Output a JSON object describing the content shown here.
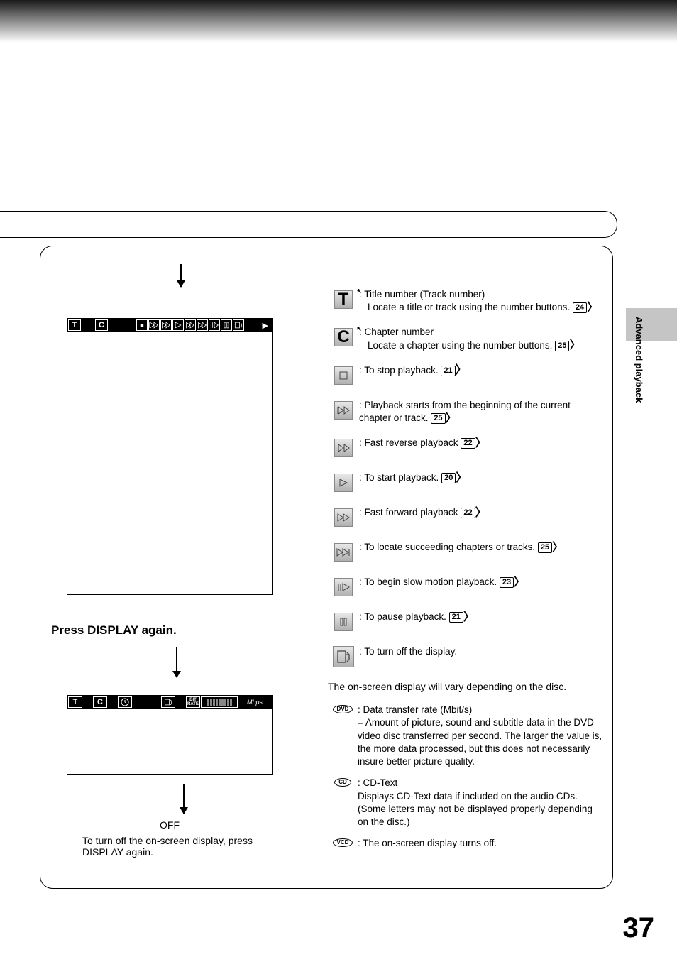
{
  "side_label": "Advanced playback",
  "page_number": "37",
  "press_heading": "Press DISPLAY again.",
  "off_label": "OFF",
  "off_note": "To turn off the on-screen display, press DISPLAY again.",
  "osd1": {
    "t": "T",
    "c": "C"
  },
  "osd2": {
    "t": "T",
    "c": "C",
    "bitrate_label": "BIT RATE",
    "mbps": "Mbps"
  },
  "legend": {
    "title": {
      "letter": "T",
      "star": "*",
      "main": ": Title number (Track number)",
      "desc": "Locate a title or track using the number buttons.",
      "ref": "24"
    },
    "chapter": {
      "letter": "C",
      "star": "*",
      "main": ": Chapter number",
      "desc": "Locate a chapter using the number buttons.",
      "ref": "25"
    },
    "stop": {
      "main": ": To stop playback.",
      "ref": "21"
    },
    "prev": {
      "main": ": Playback starts from the beginning of the current chapter or track.",
      "ref": "25"
    },
    "rev": {
      "main": ": Fast reverse playback",
      "ref": "22"
    },
    "play": {
      "main": ": To start playback.",
      "ref": "20"
    },
    "ff": {
      "main": ": Fast forward playback",
      "ref": "22"
    },
    "next": {
      "main": ": To locate succeeding chapters or tracks.",
      "ref": "25"
    },
    "slow": {
      "main": ": To begin slow motion playback.",
      "ref": "23"
    },
    "pause": {
      "main": ": To pause playback.",
      "ref": "21"
    },
    "off": {
      "main": ": To turn off the display."
    }
  },
  "note": "The on-screen display will vary depending on the disc.",
  "discs": {
    "dvd": {
      "badge": "DVD",
      "title": ": Data transfer rate (Mbit/s)",
      "body": "= Amount of picture, sound and subtitle data in the DVD video disc transferred per second. The larger the value is, the more data processed, but this does not necessarily insure better picture quality."
    },
    "cd": {
      "badge": "CD",
      "title": ": CD-Text",
      "body": "Displays CD-Text data if included on the audio CDs. (Some letters may not be displayed properly depending on the disc.)"
    },
    "vcd": {
      "badge": "VCD",
      "title": ": The on-screen display turns off."
    }
  }
}
